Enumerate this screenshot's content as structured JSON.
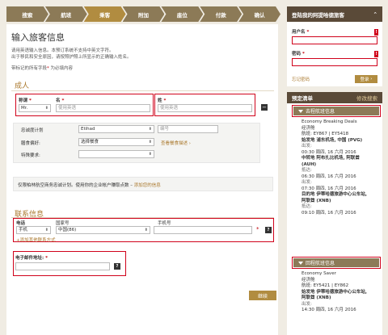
{
  "steps": [
    "搜索",
    "航班",
    "乘客",
    "附加",
    "座位",
    "付款",
    "确认"
  ],
  "active_step": 2,
  "page_title": "输入旅客信息",
  "intro_lines": [
    "请用英语输入信息。本预订系统不支持中英文字符。",
    "出于移民和安全原因，请按照护照上所显示的正确输入姓名。"
  ],
  "required_note": {
    "prefix": "带标记的所有字段",
    "star": "*",
    "suffix": " 为必填内容"
  },
  "adult": {
    "section_title": "成人",
    "title_label": "称谓",
    "title_value": "Mr.",
    "firstname_label": "名",
    "firstname_placeholder": "使用英语",
    "lastname_label": "姓",
    "lastname_placeholder": "使用英语",
    "minus": "−",
    "loyalty_label": "忠诚度计划",
    "loyalty_value": "Etihad",
    "number_placeholder": "编号",
    "meal_label": "膳食偏好:",
    "meal_value": "选择餐食",
    "meal_link": "查看餐食描述",
    "special_label": "特殊要求:",
    "star": "*"
  },
  "corporate": {
    "text": "仅限柏林航空商务忠诚计划。使用你的企业帐户赚取点数 –",
    "link": "添加您的信息"
  },
  "contact": {
    "section_title": "联系信息",
    "phone_label": "电话",
    "phone_type": "手机",
    "country_label": "国家号",
    "country_value": "中国(86)",
    "mobile_label": "手机号",
    "add_more": "+添加其他联系方式",
    "email_label": "电子邮件地址:",
    "help": "?",
    "star": "*"
  },
  "continue_label": "继续",
  "login": {
    "header": "登陆我的阿提哈德旅客",
    "username_label": "用户名",
    "password_label": "密码",
    "forgot": "忘记密码",
    "login_button": "登录",
    "star": "*",
    "bang": "!"
  },
  "booking": {
    "header": "预定清单",
    "modify": "修改搜索",
    "outbound_header": "去程航班信息",
    "outbound_lines": [
      {
        "t": "Economy Breaking Deals",
        "s": "normal"
      },
      {
        "t": "经济舱",
        "s": "normal"
      },
      {
        "t": "航班: EY867 | EY5418",
        "s": "normal"
      },
      {
        "t": "始发地 浦东机场, 中国 (PVG)",
        "s": "bold"
      },
      {
        "t": "出发:",
        "s": "muted"
      },
      {
        "t": "00:30 周四, 16 六月 2016",
        "s": "normal"
      },
      {
        "t": "中转地 阿布扎比机场, 阿联酋",
        "s": "bold"
      },
      {
        "t": "(AUH)",
        "s": "bold"
      },
      {
        "t": "抵达:",
        "s": "muted"
      },
      {
        "t": "06:30 周四, 16 六月 2016",
        "s": "normal"
      },
      {
        "t": "出发:",
        "s": "muted"
      },
      {
        "t": "07:30 周四, 16 六月 2016",
        "s": "normal"
      },
      {
        "t": "目的地 伊蒂哈德旅游中心公车站,",
        "s": "bold"
      },
      {
        "t": "阿联酋 (XNB)",
        "s": "bold"
      },
      {
        "t": "抵达:",
        "s": "muted"
      },
      {
        "t": "09:10 周四, 16 六月 2016",
        "s": "normal"
      }
    ],
    "return_header": "回程航班信息",
    "return_lines": [
      {
        "t": "Economy Saver",
        "s": "normal"
      },
      {
        "t": "经济舱",
        "s": "normal"
      },
      {
        "t": "航班: EY5421 | EY862",
        "s": "normal"
      },
      {
        "t": "始发地 伊蒂哈德旅游中心公车站,",
        "s": "bold"
      },
      {
        "t": "阿联酋 (XNB)",
        "s": "bold"
      },
      {
        "t": "出发:",
        "s": "muted"
      },
      {
        "t": "14:30 周四, 16 六月 2016",
        "s": "normal"
      }
    ]
  },
  "colors": {
    "gold": "#b18c40",
    "tan": "#8c7a57",
    "dark_brown": "#5a4a38",
    "red": "#d0021b"
  }
}
